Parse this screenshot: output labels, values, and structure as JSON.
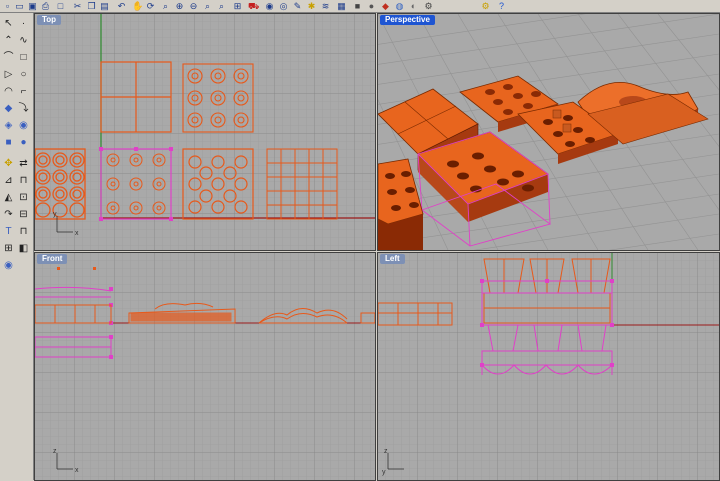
{
  "toolbar": {
    "icons": [
      "new-file",
      "open-folder",
      "save",
      "print",
      "new-doc",
      "cut",
      "copy",
      "paste",
      "undo",
      "pan",
      "rotate",
      "zoom-window",
      "zoom-in",
      "zoom-out",
      "zoom-extents",
      "zoom-selected",
      "four-viewports",
      "car-render",
      "eye",
      "target",
      "brush",
      "bulb",
      "layers",
      "grid-toggle",
      "box-shade",
      "sphere",
      "material",
      "globe",
      "rendered",
      "settings",
      "lightning",
      "help"
    ]
  },
  "left_toolbar": {
    "icons": [
      "select-arrow",
      "point",
      "polyline",
      "curve",
      "arc",
      "rectangle",
      "circle",
      "ellipse",
      "surface-patch",
      "fillet-curve",
      "solid-box",
      "extrude",
      "boolean",
      "mesh",
      "transform",
      "array",
      "move",
      "mirror",
      "dimension",
      "text",
      "analyze",
      "snap",
      "group",
      "block",
      "render"
    ]
  },
  "viewports": {
    "top": {
      "label": "Top"
    },
    "perspective": {
      "label": "Perspective"
    },
    "front": {
      "label": "Front"
    },
    "left": {
      "label": "Left"
    }
  },
  "axes": {
    "top": {
      "x": "x",
      "y": "y"
    },
    "front": {
      "x": "x",
      "z": "z"
    },
    "left": {
      "y": "y",
      "z": "z"
    }
  },
  "colors": {
    "viewport_bg": "#a9a9a9",
    "grid_minor": "#989898",
    "grid_major": "#7a7a7a",
    "object": "#e8591a",
    "selected": "#e040c8",
    "axis_green": "#2e8b2e",
    "axis_red": "#9b1a1a"
  }
}
